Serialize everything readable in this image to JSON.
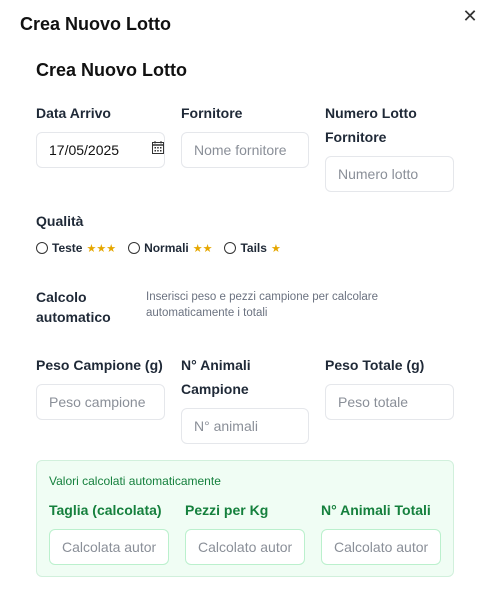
{
  "dialog": {
    "title": "Crea Nuovo Lotto",
    "close_symbol": "✕"
  },
  "form": {
    "title": "Crea Nuovo Lotto",
    "data_arrivo": {
      "label": "Data Arrivo",
      "value": "17/05/2025",
      "icon": "calendar-icon"
    },
    "fornitore": {
      "label": "Fornitore",
      "placeholder": "Nome fornitore"
    },
    "numero_lotto": {
      "label_line1": "Numero Lotto",
      "label_line2": "Fornitore",
      "placeholder": "Numero lotto"
    },
    "qualita": {
      "label": "Qualità",
      "options": [
        {
          "label": "Teste",
          "stars": "★★★"
        },
        {
          "label": "Normali",
          "stars": "★★"
        },
        {
          "label": "Tails",
          "stars": "★"
        }
      ]
    },
    "calcolo": {
      "label_line1": "Calcolo",
      "label_line2": "automatico",
      "help_line1": "Inserisci peso e pezzi campione per calcolare",
      "help_line2": "automaticamente i totali"
    },
    "peso_campione": {
      "label": "Peso Campione (g)",
      "placeholder": "Peso campione"
    },
    "animali_campione": {
      "label_line1": "N° Animali",
      "label_line2": "Campione",
      "placeholder": "N° animali"
    },
    "peso_totale": {
      "label": "Peso Totale (g)",
      "placeholder": "Peso totale"
    }
  },
  "calculated": {
    "title": "Valori calcolati automaticamente",
    "taglia": {
      "label": "Taglia (calcolata)",
      "placeholder": "Calcolata automaticamente"
    },
    "pezzi_kg": {
      "label": "Pezzi per Kg",
      "placeholder": "Calcolato automaticamente"
    },
    "animali_totali": {
      "label": "N° Animali Totali",
      "placeholder": "Calcolato automaticamente"
    }
  },
  "colors": {
    "accent_green": "#15803d",
    "green_bg": "#f0fdf4",
    "star_gold": "#e6a700"
  }
}
